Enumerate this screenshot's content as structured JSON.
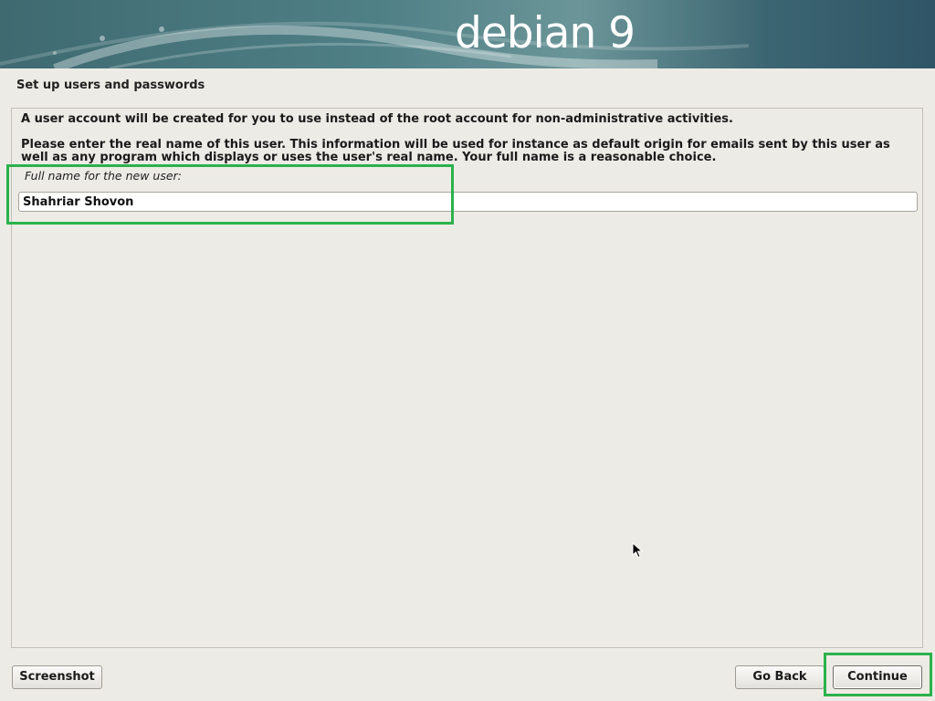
{
  "header": {
    "brand": "debian 9",
    "brand_color": "#ffffff",
    "banner_colors": [
      "#3e6a70",
      "#6b9598",
      "#2f5566"
    ]
  },
  "page": {
    "title": "Set up users and passwords"
  },
  "content": {
    "paragraph_1": "A user account will be created for you to use instead of the root account for non-administrative activities.",
    "paragraph_2": "Please enter the real name of this user. This information will be used for instance as default origin for emails sent by this user as well as any program which displays or uses the user's real name. Your full name is a reasonable choice.",
    "field_label": "Full name for the new user:",
    "field_value": "Shahriar Shovon"
  },
  "buttons": {
    "screenshot": "Screenshot",
    "go_back": "Go Back",
    "continue": "Continue"
  },
  "annotations": {
    "highlight_color": "#2bb24c"
  },
  "icons": {
    "cursor": "mouse-pointer-icon"
  }
}
